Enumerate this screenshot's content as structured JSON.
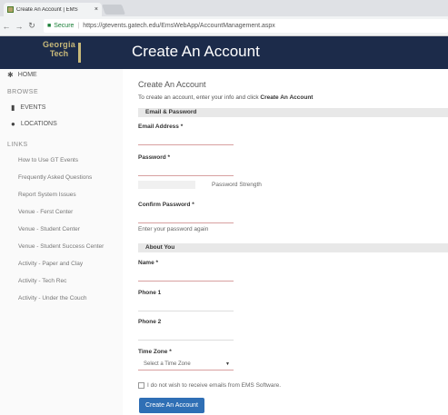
{
  "browser": {
    "tab_title": "Create An Account | EMS",
    "tab_close": "×",
    "secure_label": "Secure",
    "url": "https://gtevents.gatech.edu/EmsWebApp/AccountManagement.aspx"
  },
  "header": {
    "logo_line1": "Georgia",
    "logo_line2": "Tech",
    "title": "Create An Account"
  },
  "sidebar": {
    "home": "HOME",
    "browse_heading": "BROWSE",
    "events": "EVENTS",
    "locations": "LOCATIONS",
    "links_heading": "LINKS",
    "links": [
      "How to Use GT Events",
      "Frequently Asked Questions",
      "Report System Issues",
      "Venue - Ferst Center",
      "Venue - Student Center",
      "Venue - Student Success Center",
      "Activity - Paper and Clay",
      "Activity - Tech Rec",
      "Activity - Under the Couch"
    ]
  },
  "form": {
    "title": "Create An Account",
    "intro_prefix": "To create an account, enter your info and click ",
    "intro_action": "Create An Account",
    "section_email": "Email & Password",
    "email_label": "Email Address *",
    "password_label": "Password *",
    "password_strength": "Password Strength",
    "confirm_label": "Confirm Password *",
    "confirm_helper": "Enter your password again",
    "section_about": "About You",
    "name_label": "Name *",
    "phone1_label": "Phone 1",
    "phone2_label": "Phone 2",
    "timezone_label": "Time Zone *",
    "timezone_placeholder": "Select a Time Zone",
    "optout_label": "I do not wish to receive emails from EMS Software.",
    "submit_label": "Create An Account"
  },
  "colors": {
    "header_bg": "#1c2b4a",
    "accent_gold": "#c8b97a",
    "button_blue": "#2f6fb5"
  }
}
